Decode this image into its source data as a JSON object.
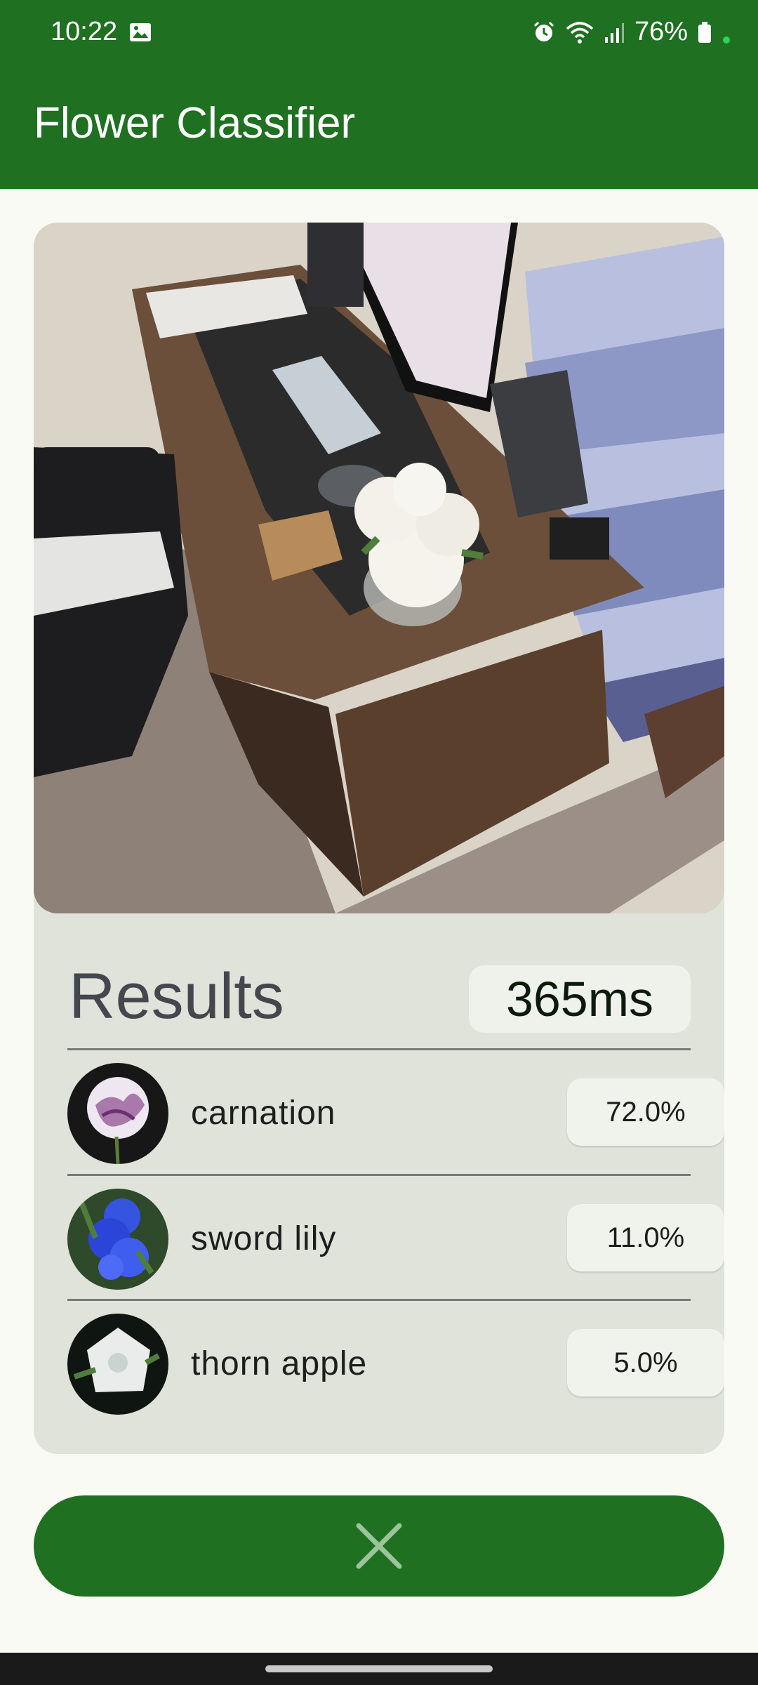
{
  "status_bar": {
    "time": "10:22",
    "battery": "76%",
    "icons": [
      "gallery-icon",
      "alarm-icon",
      "wifi-icon",
      "signal-icon",
      "battery-icon"
    ]
  },
  "app_bar": {
    "title": "Flower Classifier"
  },
  "results": {
    "title": "Results",
    "inference_time": "365ms",
    "items": [
      {
        "label": "carnation",
        "confidence": "72.0%"
      },
      {
        "label": "sword lily",
        "confidence": "11.0%"
      },
      {
        "label": "thorn apple",
        "confidence": "5.0%"
      }
    ]
  },
  "close_button": {
    "icon": "close-icon"
  },
  "colors": {
    "primary": "#1f7021",
    "card": "#dfe3d9",
    "background": "#f8faf3",
    "chip": "#eff2ea"
  }
}
